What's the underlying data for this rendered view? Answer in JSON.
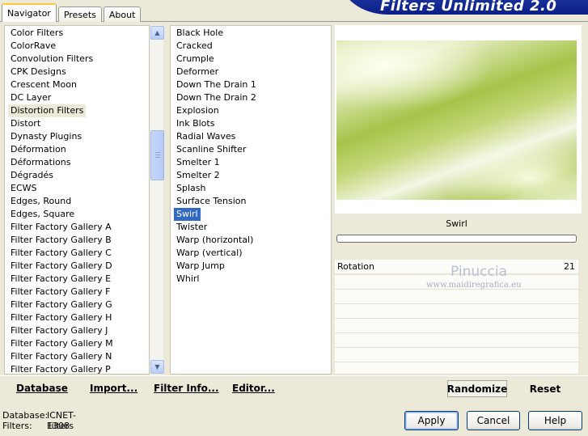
{
  "tabs": [
    {
      "label": "Navigator",
      "active": true
    },
    {
      "label": "Presets",
      "active": false
    },
    {
      "label": "About",
      "active": false
    }
  ],
  "banner_title": "Filters Unlimited 2.0",
  "categories": {
    "items": [
      "Color Filters",
      "ColorRave",
      "Convolution Filters",
      "CPK Designs",
      "Crescent Moon",
      "DC Layer",
      "Distortion Filters",
      "Distort",
      "Dynasty Plugins",
      "Déformation",
      "Déformations",
      "Dégradés",
      "ECWS",
      "Edges, Round",
      "Edges, Square",
      "Filter Factory Gallery A",
      "Filter Factory Gallery B",
      "Filter Factory Gallery C",
      "Filter Factory Gallery D",
      "Filter Factory Gallery E",
      "Filter Factory Gallery F",
      "Filter Factory Gallery G",
      "Filter Factory Gallery H",
      "Filter Factory Gallery J",
      "Filter Factory Gallery M",
      "Filter Factory Gallery N",
      "Filter Factory Gallery P"
    ],
    "highlighted": "Distortion Filters"
  },
  "filters": {
    "items": [
      "Black Hole",
      "Cracked",
      "Crumple",
      "Deformer",
      "Down The Drain 1",
      "Down The Drain 2",
      "Explosion",
      "Ink Blots",
      "Radial Waves",
      "Scanline Shifter",
      "Smelter 1",
      "Smelter 2",
      "Splash",
      "Surface Tension",
      "Swirl",
      "Twister",
      "Warp (horizontal)",
      "Warp (vertical)",
      "Warp Jump",
      "Whirl"
    ],
    "selected": "Swirl"
  },
  "bottom_buttons": {
    "database": "Database",
    "import": "Import...",
    "filter_info": "Filter Info...",
    "editor": "Editor...",
    "randomize": "Randomize",
    "reset": "Reset"
  },
  "preview": {
    "filter_name": "Swirl",
    "progress": 0
  },
  "params": [
    {
      "label": "Rotation",
      "value": "21"
    }
  ],
  "watermark": {
    "name": "Pinuccia",
    "site": "www.maidiregrafica.eu"
  },
  "status": {
    "database_label": "Database:",
    "database_value": "ICNET-Filters",
    "filters_label": "Filters:",
    "filters_value": "1308"
  },
  "dialog_buttons": {
    "apply": "Apply",
    "cancel": "Cancel",
    "help": "Help"
  }
}
